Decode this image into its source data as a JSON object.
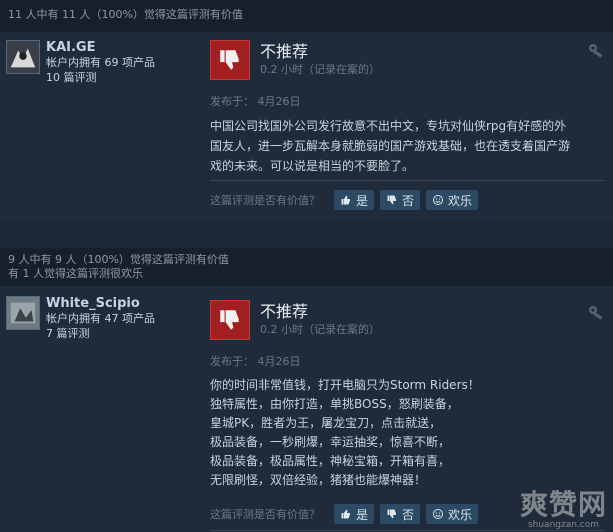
{
  "reviews": [
    {
      "helpful_line1": "11 人中有 11 人（100%）觉得这篇评测有价值",
      "helpful_line2": "",
      "author": "KAI.GE",
      "products": "帐户内拥有 69 项产品",
      "reviews_count": "10 篇评测",
      "verdict": "不推荐",
      "hours": "0.2 小时（记录在案的）",
      "posted": "发布于：  4月26日",
      "text_lines": [
        "中国公司找国外公司发行故意不出中文，专坑对仙侠rpg有好感的外",
        "国友人，进一步瓦解本身就脆弱的国产游戏基础，也在透支着国产游",
        "戏的未来。可以说是相当的不要脸了。"
      ],
      "vote_question": "这篇评测是否有价值？",
      "yes": "是",
      "no": "否",
      "funny": "欢乐"
    },
    {
      "helpful_line1": "9 人中有 9 人（100%）觉得这篇评测有价值",
      "helpful_line2": "有 1 人觉得这篇评测很欢乐",
      "author": "White_Scipio",
      "products": "帐户内拥有 47 项产品",
      "reviews_count": "7 篇评测",
      "verdict": "不推荐",
      "hours": "0.2 小时（记录在案的）",
      "posted": "发布于：  4月26日",
      "text_lines": [
        "你的时间非常值钱，打开电脑只为Storm Riders！",
        "独特属性，由你打造，单挑BOSS，怒刷装备，",
        "皇城PK，胜者为王，屠龙宝刀，点击就送，",
        "极品装备，一秒刷爆，幸运抽奖，惊喜不断，",
        "极品装备，极品属性，神秘宝箱，开箱有喜，",
        "无限刷怪，双倍经验，猪猪也能爆神器！"
      ],
      "vote_question": "这篇评测是否有价值？",
      "yes": "是",
      "no": "否",
      "funny": "欢乐"
    }
  ],
  "watermark": {
    "main": "爽赞网",
    "url": "shuangzan.com"
  },
  "colors": {
    "thumb_bg": "#a32022",
    "page_bg": "#1b2838"
  }
}
